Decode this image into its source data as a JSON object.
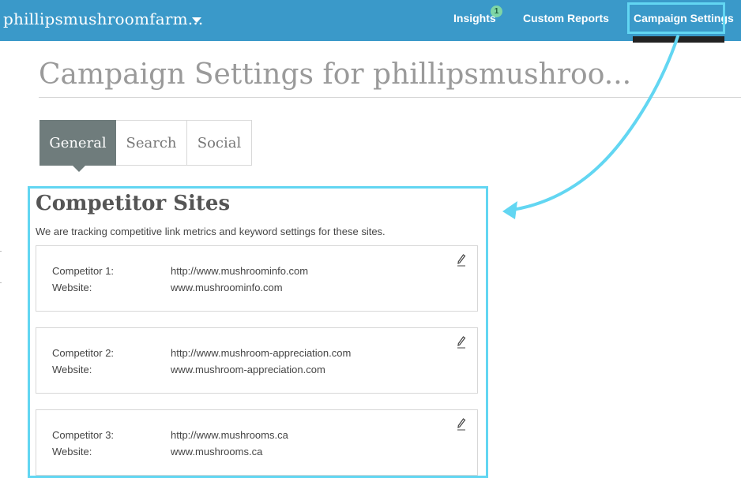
{
  "topbar": {
    "brand": "phillipsmushroomfarm...",
    "nav": {
      "insights": "Insights",
      "insights_badge": "1",
      "custom_reports": "Custom Reports",
      "campaign_settings": "Campaign Settings"
    },
    "colors": {
      "bar": "#3a99c9",
      "highlight": "#62d6f2",
      "badge": "#7fd6a6"
    }
  },
  "page": {
    "title": "Campaign Settings for phillipsmushroo..."
  },
  "tabs": [
    {
      "label": "General",
      "active": true
    },
    {
      "label": "Search",
      "active": false
    },
    {
      "label": "Social",
      "active": false
    }
  ],
  "competitors": {
    "title": "Competitor Sites",
    "description": "We are tracking competitive link metrics and keyword settings for these sites.",
    "website_label": "Website:",
    "items": [
      {
        "label": "Competitor 1:",
        "url": "http://www.mushroominfo.com",
        "website": "www.mushroominfo.com"
      },
      {
        "label": "Competitor 2:",
        "url": "http://www.mushroom-appreciation.com",
        "website": "www.mushroom-appreciation.com"
      },
      {
        "label": "Competitor 3:",
        "url": "http://www.mushrooms.ca",
        "website": "www.mushrooms.ca"
      }
    ],
    "edit_icon": "pencil-icon"
  }
}
